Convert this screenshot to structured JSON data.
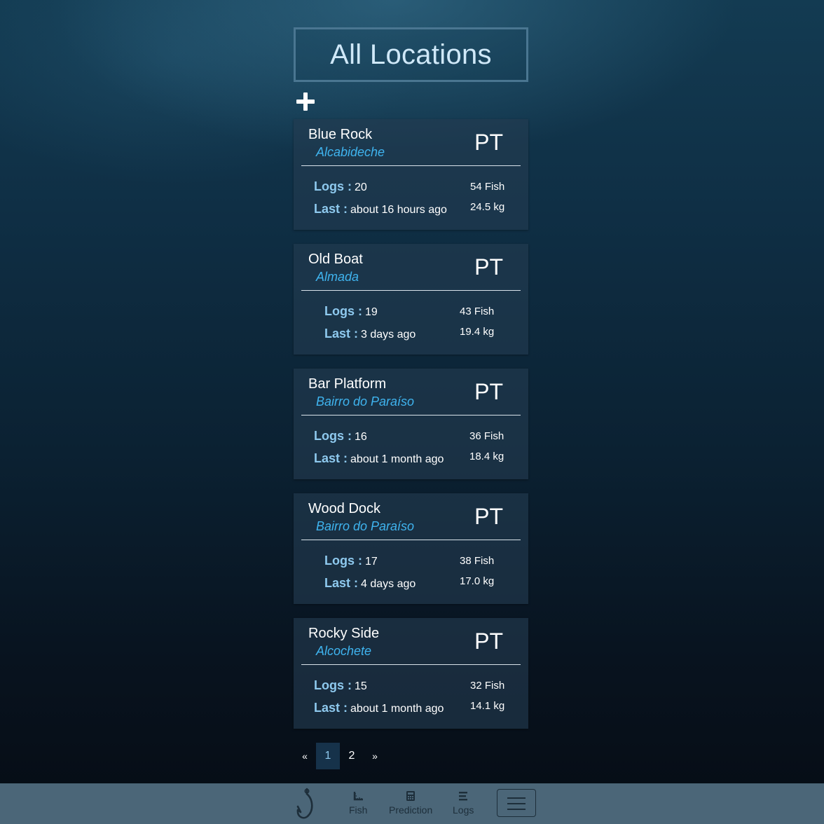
{
  "page": {
    "title": "All Locations"
  },
  "locations": [
    {
      "name": "Blue Rock",
      "city": "Alcabideche",
      "country": "PT",
      "logs_label": "Logs :",
      "logs": "20",
      "last_label": "Last :",
      "last": "about 16 hours ago",
      "fish": "54 Fish",
      "weight": "24.5 kg"
    },
    {
      "name": "Old Boat",
      "city": "Almada",
      "country": "PT",
      "logs_label": "Logs :",
      "logs": "19",
      "last_label": "Last :",
      "last": "3 days ago",
      "fish": "43 Fish",
      "weight": "19.4 kg"
    },
    {
      "name": "Bar Platform",
      "city": "Bairro do Paraíso",
      "country": "PT",
      "logs_label": "Logs :",
      "logs": "16",
      "last_label": "Last :",
      "last": "about 1 month ago",
      "fish": "36 Fish",
      "weight": "18.4 kg"
    },
    {
      "name": "Wood Dock",
      "city": "Bairro do Paraíso",
      "country": "PT",
      "logs_label": "Logs :",
      "logs": "17",
      "last_label": "Last :",
      "last": "4 days ago",
      "fish": "38 Fish",
      "weight": "17.0 kg"
    },
    {
      "name": "Rocky Side",
      "city": "Alcochete",
      "country": "PT",
      "logs_label": "Logs :",
      "logs": "15",
      "last_label": "Last :",
      "last": "about 1 month ago",
      "fish": "32 Fish",
      "weight": "14.1 kg"
    }
  ],
  "pagination": {
    "prev": "«",
    "pages": [
      "1",
      "2"
    ],
    "current": "1",
    "next": "»"
  },
  "navbar": {
    "items": [
      {
        "label": "Fish",
        "icon": "ruler-icon"
      },
      {
        "label": "Prediction",
        "icon": "calculator-icon"
      },
      {
        "label": "Logs",
        "icon": "list-icon"
      }
    ],
    "logo_icon": "fish-hook-icon",
    "toggle_icon": "hamburger-menu-icon"
  }
}
